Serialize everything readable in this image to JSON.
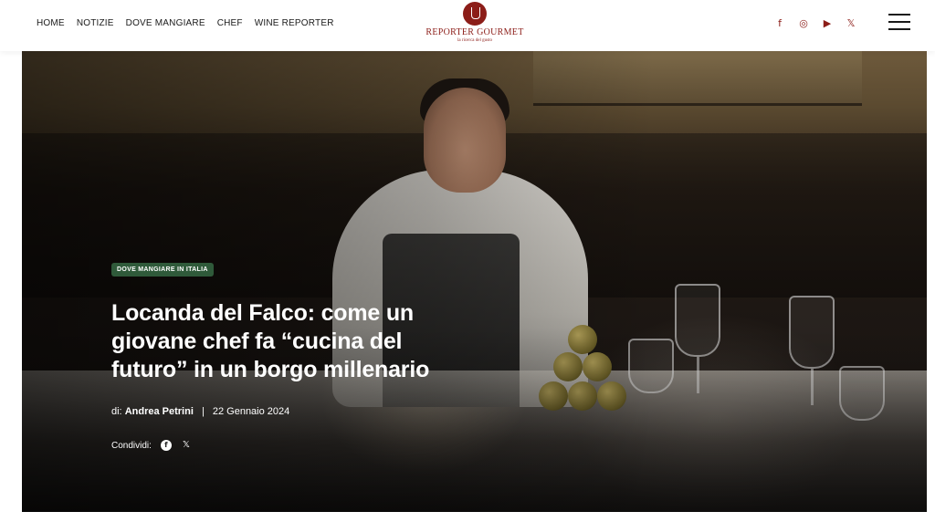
{
  "nav": {
    "items": [
      "HOME",
      "NOTIZIE",
      "DOVE MANGIARE",
      "CHEF",
      "WINE REPORTER"
    ]
  },
  "logo": {
    "name": "REPORTER GOURMET",
    "tagline": "la ricerca del gusto"
  },
  "social": {
    "icons": [
      "facebook-icon",
      "instagram-icon",
      "youtube-icon",
      "x-icon"
    ],
    "glyphs": [
      "f",
      "◎",
      "▶",
      "𝕏"
    ]
  },
  "hero": {
    "category": "DOVE MANGIARE IN ITALIA",
    "title": "Locanda del Falco: come un giovane chef fa “cucina del futuro” in un borgo millenario",
    "byline_prefix": "di:",
    "author": "Andrea Petrini",
    "separator": "|",
    "date": "22 Gennaio 2024",
    "share_label": "Condividi:",
    "share_facebook_glyph": "f",
    "share_x_glyph": "𝕏"
  },
  "colors": {
    "brand": "#8c1d18",
    "badge": "#2f5a3a"
  }
}
